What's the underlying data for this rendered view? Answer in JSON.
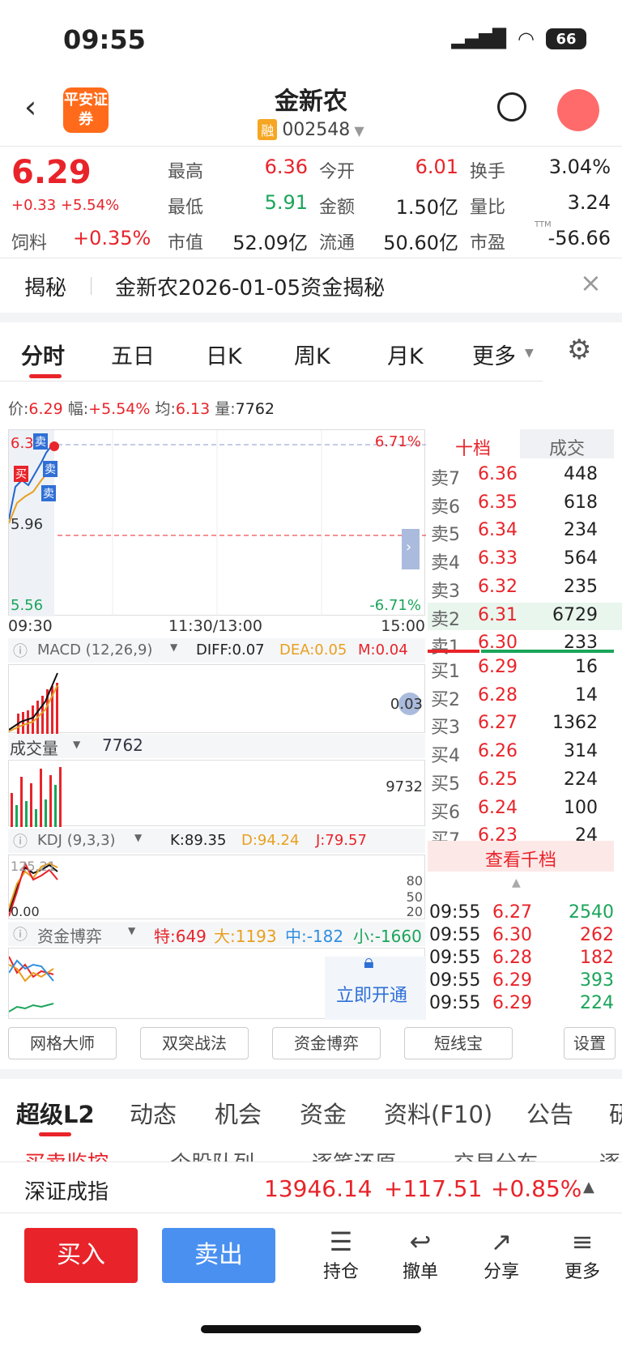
{
  "status": {
    "time": "09:55",
    "battery": "66"
  },
  "nav": {
    "logo": "平安证券",
    "title": "金新农",
    "rong": "融",
    "code": "002548"
  },
  "quote": {
    "price": "6.29",
    "change": "+0.33",
    "change_pct": "+5.54%",
    "sector_label": "饲料",
    "sector_pct": "+0.35%",
    "high_label": "最高",
    "high": "6.36",
    "low_label": "最低",
    "low": "5.91",
    "cap_label": "市值",
    "cap": "52.09亿",
    "open_label": "今开",
    "open": "6.01",
    "amount_label": "金额",
    "amount": "1.50亿",
    "float_label": "流通",
    "float": "50.60亿",
    "turnover_label": "换手",
    "turnover": "3.04%",
    "ratio_label": "量比",
    "ratio": "3.24",
    "pe_label": "市盈",
    "pe_sup": "TTM",
    "pe": "-56.66"
  },
  "reveal": {
    "tag": "揭秘",
    "text": "金新农2026-01-05资金揭秘"
  },
  "chart_tabs": [
    "分时",
    "五日",
    "日K",
    "周K",
    "月K",
    "更多"
  ],
  "info_line": {
    "price_label": "价:",
    "price": "6.29",
    "amp_label": "幅:",
    "amp": "+5.54%",
    "avg_label": "均:",
    "avg": "6.13",
    "vol_label": "量:",
    "vol": "7762"
  },
  "chart": {
    "y_top": "6.3",
    "pct_top": "6.71%",
    "y_mid": "5.96",
    "y_bot": "5.56",
    "pct_bot": "-6.71%",
    "t_start": "09:30",
    "t_mid": "11:30/13:00",
    "t_end": "15:00",
    "buy_tag": "买",
    "sell_tag": "卖",
    "macd_label": "MACD (12,26,9)",
    "diff": "DIFF:0.07",
    "dea": "DEA:0.05",
    "m": "M:0.04",
    "macd_right": "0.03",
    "vol_label": "成交量",
    "vol_val": "7762",
    "vol_right": "9732",
    "kdj_label": "KDJ (9,3,3)",
    "k": "K:89.35",
    "d": "D:94.24",
    "j": "J:79.57",
    "kdj_left_top": "125.21",
    "kdj_left_bot": "0.00",
    "kdj_80": "80",
    "kdj_50": "50",
    "kdj_20": "20",
    "fund_label": "资金博弈",
    "te": "特:649",
    "da": "大:1193",
    "zhong": "中:-182",
    "xiao": "小:-1660",
    "unlock": "立即开通"
  },
  "orderbook": {
    "tab1": "十档",
    "tab2": "成交",
    "asks": [
      {
        "label": "卖7",
        "price": "6.36",
        "vol": "448"
      },
      {
        "label": "卖6",
        "price": "6.35",
        "vol": "618"
      },
      {
        "label": "卖5",
        "price": "6.34",
        "vol": "234"
      },
      {
        "label": "卖4",
        "price": "6.33",
        "vol": "564"
      },
      {
        "label": "卖3",
        "price": "6.32",
        "vol": "235"
      },
      {
        "label": "卖2",
        "price": "6.31",
        "vol": "6729"
      },
      {
        "label": "卖1",
        "price": "6.30",
        "vol": "233"
      }
    ],
    "bids": [
      {
        "label": "买1",
        "price": "6.29",
        "vol": "16"
      },
      {
        "label": "买2",
        "price": "6.28",
        "vol": "14"
      },
      {
        "label": "买3",
        "price": "6.27",
        "vol": "1362"
      },
      {
        "label": "买4",
        "price": "6.26",
        "vol": "314"
      },
      {
        "label": "买5",
        "price": "6.25",
        "vol": "224"
      },
      {
        "label": "买6",
        "price": "6.24",
        "vol": "100"
      },
      {
        "label": "买7",
        "price": "6.23",
        "vol": "24"
      }
    ],
    "view_all": "查看千档",
    "trades": [
      {
        "time": "09:55",
        "price": "6.27",
        "vol": "2540"
      },
      {
        "time": "09:55",
        "price": "6.30",
        "vol": "262"
      },
      {
        "time": "09:55",
        "price": "6.28",
        "vol": "182"
      },
      {
        "time": "09:55",
        "price": "6.29",
        "vol": "393"
      },
      {
        "time": "09:55",
        "price": "6.29",
        "vol": "224"
      }
    ]
  },
  "tools": [
    "网格大师",
    "双突战法",
    "资金博弈",
    "短线宝",
    "设置"
  ],
  "bottom_tabs": [
    "超级L2",
    "动态",
    "机会",
    "资金",
    "资料(F10)",
    "公告",
    "研"
  ],
  "sub_tabs": [
    "买卖监控",
    "个股队列",
    "逐笔还原",
    "交易分布",
    "逐"
  ],
  "index": {
    "name": "深证成指",
    "value": "13946.14",
    "change": "+117.51",
    "pct": "+0.85%"
  },
  "actions": {
    "buy": "买入",
    "sell": "卖出",
    "hold": "持仓",
    "cancel": "撤单",
    "share": "分享",
    "more": "更多"
  }
}
